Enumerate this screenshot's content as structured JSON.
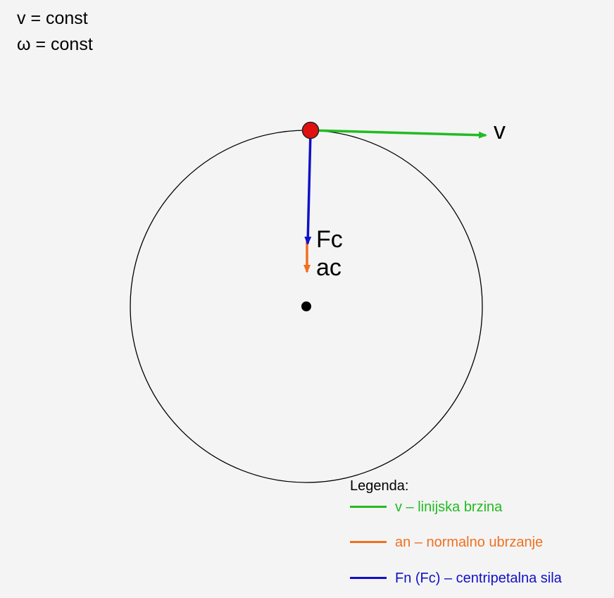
{
  "info": {
    "line1": "v = const",
    "line2": "ω = const"
  },
  "vectors": {
    "velocity_label": "v",
    "force_label": "Fc",
    "acceleration_label": "ac"
  },
  "colors": {
    "velocity": "#22bb22",
    "acceleration": "#f07020",
    "force": "#1010c8",
    "particle": "#e01010",
    "circle": "#000000",
    "center": "#000000"
  },
  "legend": {
    "title": "Legenda:",
    "items": [
      {
        "label": "v – linijska brzina",
        "color": "#22bb22"
      },
      {
        "label": "an – normalno ubrzanje",
        "color": "#f07020"
      },
      {
        "label": "Fn (Fc) – centripetalna sila",
        "color": "#1010c8"
      }
    ]
  }
}
